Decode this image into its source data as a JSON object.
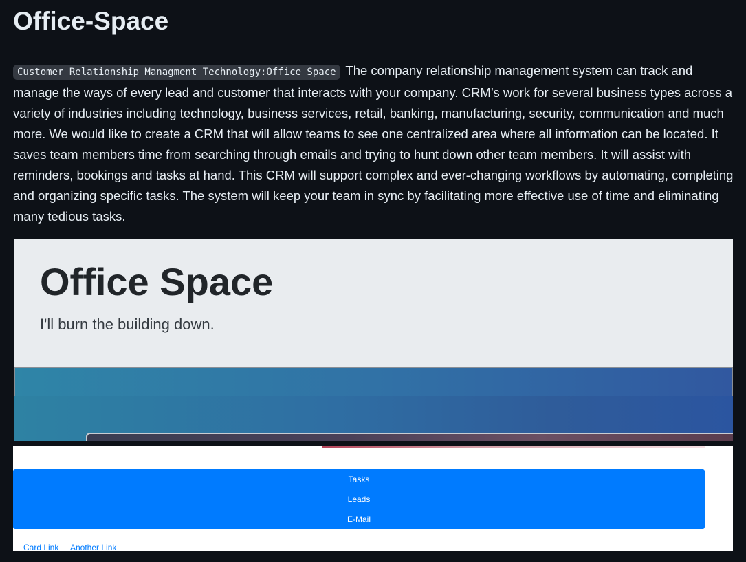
{
  "page": {
    "title": "Office-Space"
  },
  "description": {
    "code_label": "Customer Relationship Managment Technology:Office Space",
    "text": "The company relationship management system can track and manage the ways of every lead and customer that interacts with your company. CRM’s work for several business types across a variety of industries including technology, business services, retail, banking, manufacturing, security, communication and much more. We would like to create a CRM that will allow teams to see one centralized area where all information can be located. It saves team members time from searching through emails and trying to hunt down other team members. It will assist with reminders, bookings and tasks at hand. This CRM will support complex and ever-changing workflows by automating, completing and organizing specific tasks. The system will keep your team in sync by facilitating more effective use of time and eliminating many tedious tasks."
  },
  "screenshot_one": {
    "heading": "Office Space",
    "lead": "I'll burn the building down."
  },
  "screenshot_two": {
    "nav": [
      "Tasks",
      "Leads",
      "E-Mail"
    ],
    "links": [
      "Card Link",
      "Another Link"
    ]
  },
  "colors": {
    "page_background": "#0d1117",
    "jumbotron_background": "#e9ecef",
    "nav_blue": "#007bff",
    "link_blue": "#007bff"
  }
}
